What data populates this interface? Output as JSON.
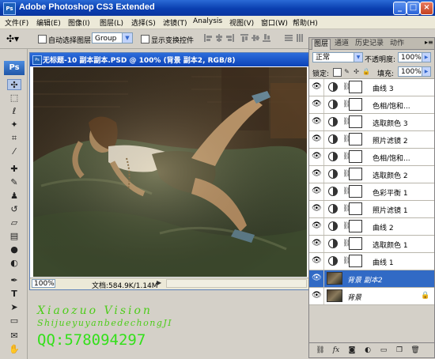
{
  "window": {
    "title": "Adobe Photoshop CS3 Extended",
    "controls": [
      "_",
      "□",
      "×"
    ]
  },
  "menu": [
    "文件(F)",
    "编辑(E)",
    "图像(I)",
    "图层(L)",
    "选择(S)",
    "滤镜(T)",
    "Analysis",
    "视图(V)",
    "窗口(W)",
    "帮助(H)"
  ],
  "options": {
    "auto_select_label": "自动选择图层",
    "group_value": "Group",
    "show_transform_label": "显示变换控件"
  },
  "document": {
    "title": "无标题-10 副本副本.PSD @ 100% (背景 副本2, RGB/8)",
    "zoom": "100%",
    "doc_info": "文档:584.9K/1.14M"
  },
  "watermark": {
    "line1": "Xiaozuo Vision",
    "line2": "ShijueyuyanbedechongJI",
    "line3": "QQ:578094297"
  },
  "layers_panel": {
    "tabs": [
      "图层",
      "通道",
      "历史记录",
      "动作"
    ],
    "blend_mode": "正常",
    "opacity_label": "不透明度:",
    "opacity_value": "100%",
    "lock_label": "锁定:",
    "fill_label": "填充:",
    "fill_value": "100%",
    "layers": [
      {
        "name": "曲线 3",
        "kind": "adjustment"
      },
      {
        "name": "色相/饱和...",
        "kind": "adjustment"
      },
      {
        "name": "选取颜色 3",
        "kind": "adjustment"
      },
      {
        "name": "照片滤镜 2",
        "kind": "adjustment"
      },
      {
        "name": "色相/饱和...",
        "kind": "adjustment"
      },
      {
        "name": "选取颜色 2",
        "kind": "adjustment"
      },
      {
        "name": "色彩平衡 1",
        "kind": "adjustment"
      },
      {
        "name": "照片滤镜 1",
        "kind": "adjustment"
      },
      {
        "name": "曲线 2",
        "kind": "adjustment"
      },
      {
        "name": "选取颜色 1",
        "kind": "adjustment"
      },
      {
        "name": "曲线 1",
        "kind": "adjustment"
      },
      {
        "name": "背景 副本2",
        "kind": "pixel",
        "selected": true
      },
      {
        "name": "背景",
        "kind": "background",
        "locked": true
      }
    ]
  },
  "colors": {
    "titlebar": "#0a3fb0",
    "selection": "#316ac5",
    "watermark": "#4dcc1a"
  }
}
